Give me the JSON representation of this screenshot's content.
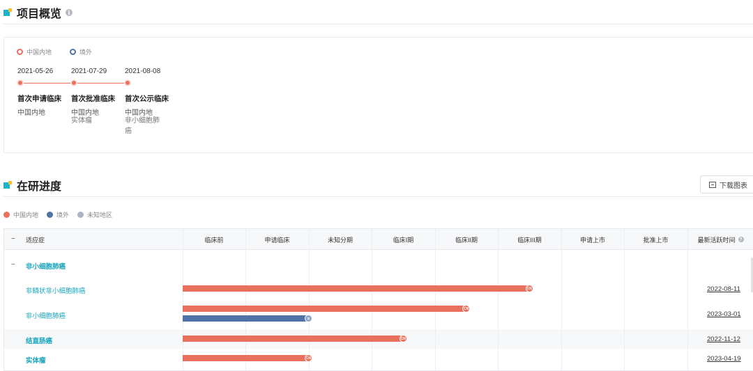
{
  "overview": {
    "title": "项目概览",
    "info_icon": "i",
    "legend": [
      {
        "label": "中国内地",
        "color": "#e8705d"
      },
      {
        "label": "境外",
        "color": "#4f73a6"
      }
    ],
    "timeline": [
      {
        "date": "2021-05-26",
        "stage": "首次申请临床",
        "region": "中国内地",
        "extra": ""
      },
      {
        "date": "2021-07-29",
        "stage": "首次批准临床",
        "region": "中国内地",
        "extra": "实体瘤"
      },
      {
        "date": "2021-08-08",
        "stage": "首次公示临床",
        "region": "中国内地",
        "extra": "非小细胞肺癌"
      }
    ]
  },
  "progress": {
    "title": "在研进度",
    "download_label": "下载图表",
    "legend": [
      {
        "label": "中国内地",
        "color": "#e8705d"
      },
      {
        "label": "境外",
        "color": "#4f73a6"
      },
      {
        "label": "未知地区",
        "color": "#a9b3c1"
      }
    ],
    "header": {
      "collapse": "−",
      "indication": "适应症",
      "phases": [
        "临床前",
        "申请临床",
        "未知分期",
        "临床I期",
        "临床II期",
        "临床III期",
        "申请上市",
        "批准上市"
      ],
      "latest": "最新活跃时间"
    },
    "rows": [
      {
        "label": "非小细胞肺癌",
        "group": true,
        "collapse": "−",
        "date": ""
      },
      {
        "label": "非鳞状非小细胞肺癌",
        "group": false,
        "date": "2022-08-11",
        "bars": [
          {
            "region": "CN",
            "stage_progress": 5.5,
            "tag": "CN"
          }
        ]
      },
      {
        "label": "非小细胞肺癌",
        "group": false,
        "date": "2023-03-01",
        "bars": [
          {
            "region": "CN",
            "stage_progress": 4.5,
            "tag": "CN"
          },
          {
            "region": "EX",
            "stage_progress": 2.0,
            "tag": "globe"
          }
        ]
      },
      {
        "label": "结直肠癌",
        "group": false,
        "bold": true,
        "date": "2022-11-12",
        "bars": [
          {
            "region": "CN",
            "stage_progress": 3.5,
            "tag": "CN"
          }
        ]
      },
      {
        "label": "实体瘤",
        "group": false,
        "bold": true,
        "date": "2023-04-19",
        "bars": [
          {
            "region": "CN",
            "stage_progress": 2.0,
            "tag": "CN"
          }
        ]
      }
    ]
  }
}
